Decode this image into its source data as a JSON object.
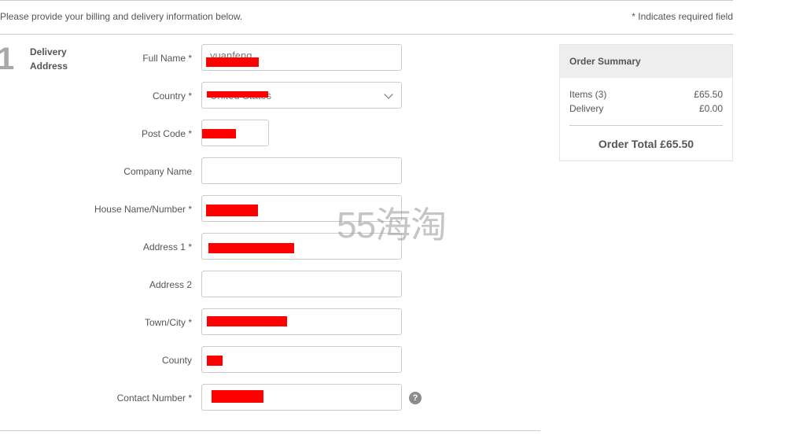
{
  "header": {
    "intro": "Please provide your billing and delivery information below.",
    "required_note": "* Indicates required field"
  },
  "step": {
    "number": "1",
    "title": "Delivery Address"
  },
  "fields": [
    {
      "label": "Full Name *",
      "value": "yuanfeng",
      "redacted": true
    },
    {
      "label": "Country *",
      "value": "United States",
      "redacted": true,
      "type": "select"
    },
    {
      "label": "Post Code *",
      "value": "",
      "redacted": true
    },
    {
      "label": "Company Name",
      "value": ""
    },
    {
      "label": "House Name/Number *",
      "value": "",
      "redacted": true
    },
    {
      "label": "Address 1 *",
      "value": "",
      "redacted": true
    },
    {
      "label": "Address 2",
      "value": ""
    },
    {
      "label": "Town/City *",
      "value": "",
      "redacted": true
    },
    {
      "label": "County",
      "value": "",
      "redacted": true
    },
    {
      "label": "Contact Number *",
      "value": "",
      "redacted": true
    }
  ],
  "help_icon": "?",
  "order_summary": {
    "title": "Order Summary",
    "items_label": "Items (3)",
    "items_value": "£65.50",
    "delivery_label": "Delivery",
    "delivery_value": "£0.00",
    "total": "Order Total £65.50"
  },
  "watermark": "55海淘",
  "colors": {
    "redaction": "#ff0000",
    "summary_header_bg": "#eeeeee",
    "text": "#555555"
  }
}
